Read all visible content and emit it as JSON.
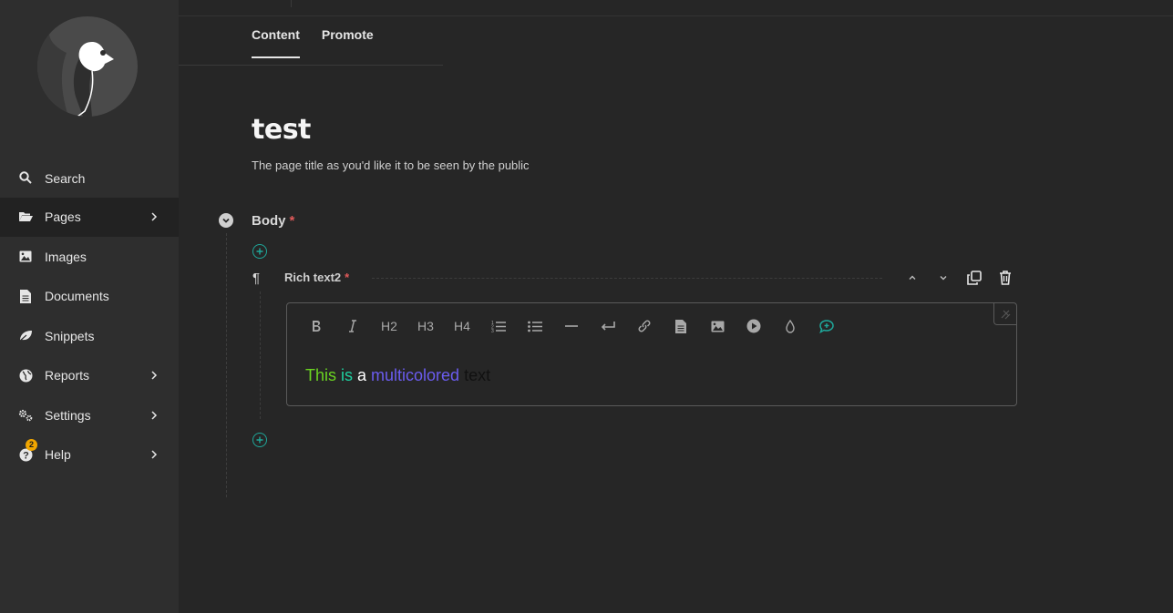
{
  "sidebar": {
    "items": [
      {
        "label": "Search"
      },
      {
        "label": "Pages"
      },
      {
        "label": "Images"
      },
      {
        "label": "Documents"
      },
      {
        "label": "Snippets"
      },
      {
        "label": "Reports"
      },
      {
        "label": "Settings"
      },
      {
        "label": "Help",
        "badge": "2"
      }
    ]
  },
  "tabs": [
    {
      "label": "Content"
    },
    {
      "label": "Promote"
    }
  ],
  "page": {
    "title": "test",
    "help_text": "The page title as you'd like it to be seen by the public"
  },
  "body": {
    "label": "Body",
    "required": "*",
    "block": {
      "label": "Rich text2",
      "required": "*",
      "toolbar": {
        "h2": "H2",
        "h3": "H3",
        "h4": "H4"
      },
      "content": [
        {
          "text": "This",
          "color": "#6bd421"
        },
        {
          "text": " is",
          "color": "#1ed1a1"
        },
        {
          "text": " a ",
          "color": "#ffffff"
        },
        {
          "text": "multicolored",
          "color": "#6b5cf0"
        },
        {
          "text": " text",
          "color": "#111111"
        }
      ]
    }
  },
  "colors": {
    "accent": "#1fa89b",
    "required": "#e05a5a",
    "badge": "#f0a500"
  }
}
